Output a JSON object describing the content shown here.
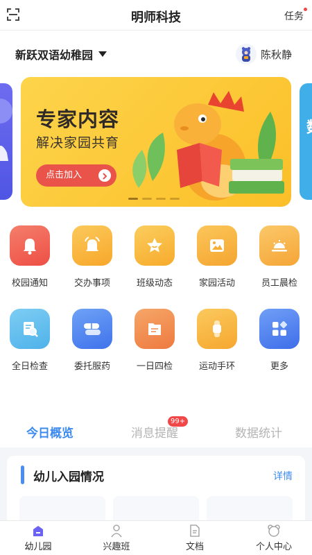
{
  "header": {
    "title": "明师科技",
    "task_label": "任务"
  },
  "school": {
    "name": "新跃双语幼稚园",
    "user_name": "陈秋静"
  },
  "banner": {
    "title": "专家内容",
    "subtitle": "解决家园共育",
    "button_label": "点击加入",
    "side_right_char": "数"
  },
  "grid": [
    {
      "label": "校园通知",
      "icon": "bell-icon",
      "color": "#ef5a4f"
    },
    {
      "label": "交办事项",
      "icon": "alarm-icon",
      "color": "#f9b234"
    },
    {
      "label": "班级动态",
      "icon": "star-icon",
      "color": "#f8b731"
    },
    {
      "label": "家园活动",
      "icon": "picture-icon",
      "color": "#f6ae35"
    },
    {
      "label": "员工晨检",
      "icon": "sunrise-icon",
      "color": "#f8b03a"
    },
    {
      "label": "全日检查",
      "icon": "magnifier-document-icon",
      "color": "#57b8ee"
    },
    {
      "label": "委托服药",
      "icon": "capsule-icon",
      "color": "#4d86f0"
    },
    {
      "label": "一日四检",
      "icon": "checklist-icon",
      "color": "#f1894f"
    },
    {
      "label": "运动手环",
      "icon": "smartwatch-icon",
      "color": "#f8b43b"
    },
    {
      "label": "更多",
      "icon": "more-apps-icon",
      "color": "#4f7ff0"
    }
  ],
  "tabs": {
    "overview": "今日概览",
    "messages": "消息提醒",
    "messages_badge": "99+",
    "stats": "数据统计"
  },
  "card": {
    "title": "幼儿入园情况",
    "detail": "详情"
  },
  "nav": {
    "kindergarten": "幼儿园",
    "interest": "兴趣班",
    "docs": "文档",
    "profile": "个人中心"
  },
  "colors": {
    "accent": "#3e8bf0",
    "banner": "#fcc83a",
    "badge": "#f04848"
  }
}
